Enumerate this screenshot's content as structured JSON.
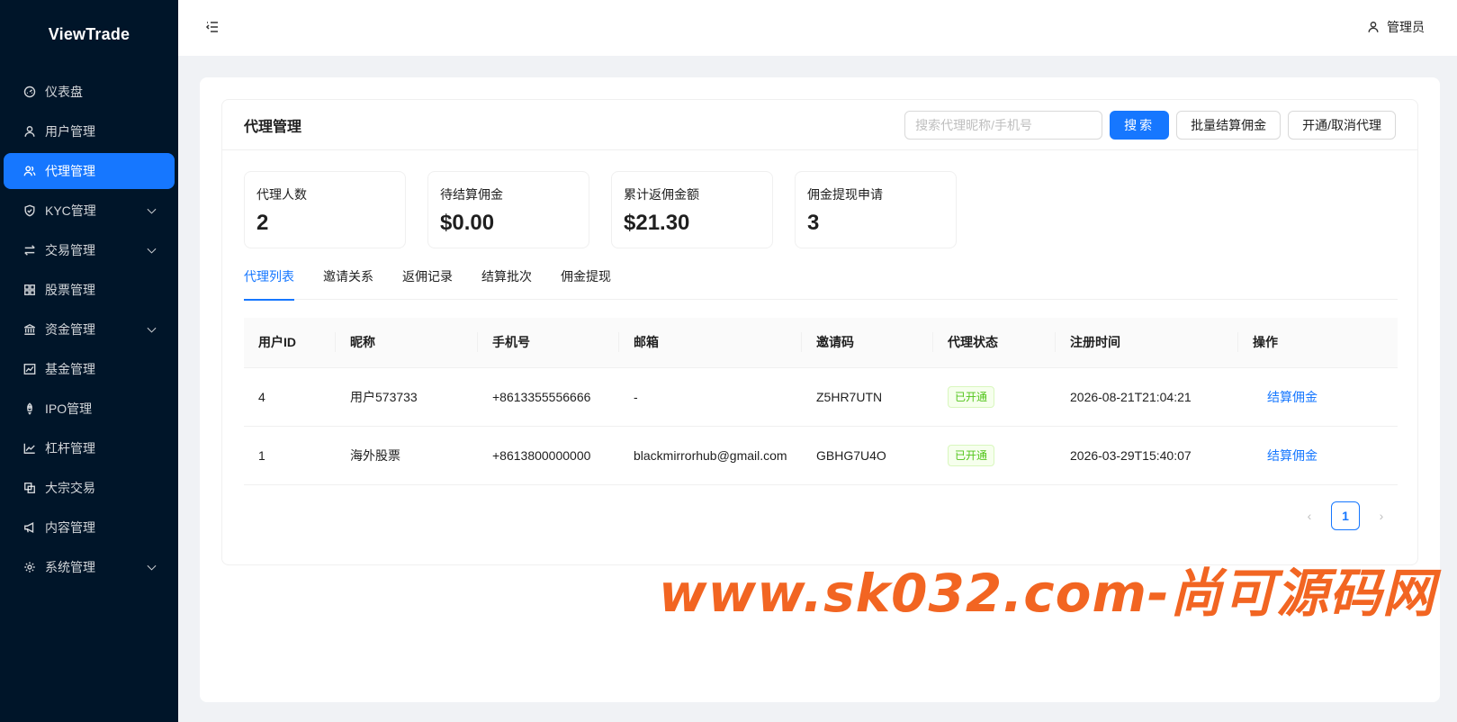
{
  "app": {
    "title": "ViewTrade"
  },
  "sidebar": {
    "items": [
      {
        "label": "仪表盘",
        "icon": "dashboard-icon",
        "active": false,
        "expandable": false
      },
      {
        "label": "用户管理",
        "icon": "user-icon",
        "active": false,
        "expandable": false
      },
      {
        "label": "代理管理",
        "icon": "agent-icon",
        "active": true,
        "expandable": false
      },
      {
        "label": "KYC管理",
        "icon": "shield-icon",
        "active": false,
        "expandable": true
      },
      {
        "label": "交易管理",
        "icon": "swap-icon",
        "active": false,
        "expandable": true
      },
      {
        "label": "股票管理",
        "icon": "grid-icon",
        "active": false,
        "expandable": false
      },
      {
        "label": "资金管理",
        "icon": "bank-icon",
        "active": false,
        "expandable": true
      },
      {
        "label": "基金管理",
        "icon": "chart-icon",
        "active": false,
        "expandable": false
      },
      {
        "label": "IPO管理",
        "icon": "rocket-icon",
        "active": false,
        "expandable": false
      },
      {
        "label": "杠杆管理",
        "icon": "line-chart-icon",
        "active": false,
        "expandable": false
      },
      {
        "label": "大宗交易",
        "icon": "block-icon",
        "active": false,
        "expandable": false
      },
      {
        "label": "内容管理",
        "icon": "megaphone-icon",
        "active": false,
        "expandable": false
      },
      {
        "label": "系统管理",
        "icon": "gear-icon",
        "active": false,
        "expandable": true
      }
    ]
  },
  "header": {
    "user_label": "管理员"
  },
  "page": {
    "title": "代理管理",
    "search_placeholder": "搜索代理昵称/手机号",
    "search_button": "搜索",
    "batch_button": "批量结算佣金",
    "toggle_button": "开通/取消代理"
  },
  "stats": [
    {
      "label": "代理人数",
      "value": "2"
    },
    {
      "label": "待结算佣金",
      "value": "$0.00"
    },
    {
      "label": "累计返佣金额",
      "value": "$21.30"
    },
    {
      "label": "佣金提现申请",
      "value": "3"
    }
  ],
  "tabs": [
    {
      "label": "代理列表",
      "active": true
    },
    {
      "label": "邀请关系",
      "active": false
    },
    {
      "label": "返佣记录",
      "active": false
    },
    {
      "label": "结算批次",
      "active": false
    },
    {
      "label": "佣金提现",
      "active": false
    }
  ],
  "table": {
    "columns": [
      "用户ID",
      "昵称",
      "手机号",
      "邮箱",
      "邀请码",
      "代理状态",
      "注册时间",
      "操作"
    ],
    "rows": [
      {
        "id": "4",
        "nickname": "用户573733",
        "phone": "+8613355556666",
        "email": "-",
        "invite": "Z5HR7UTN",
        "status": "已开通",
        "registered": "2026-08-21T21:04:21",
        "action": "结算佣金"
      },
      {
        "id": "1",
        "nickname": "海外股票",
        "phone": "+8613800000000",
        "email": "blackmirrorhub@gmail.com",
        "invite": "GBHG7U4O",
        "status": "已开通",
        "registered": "2026-03-29T15:40:07",
        "action": "结算佣金"
      }
    ]
  },
  "pagination": {
    "current": "1",
    "prev": "‹",
    "next": "›"
  },
  "watermark": "www.sk032.com-尚可源码网",
  "colors": {
    "primary": "#1677ff",
    "sidebar_bg": "#001529",
    "success": "#52c41a",
    "watermark": "#f26522"
  }
}
